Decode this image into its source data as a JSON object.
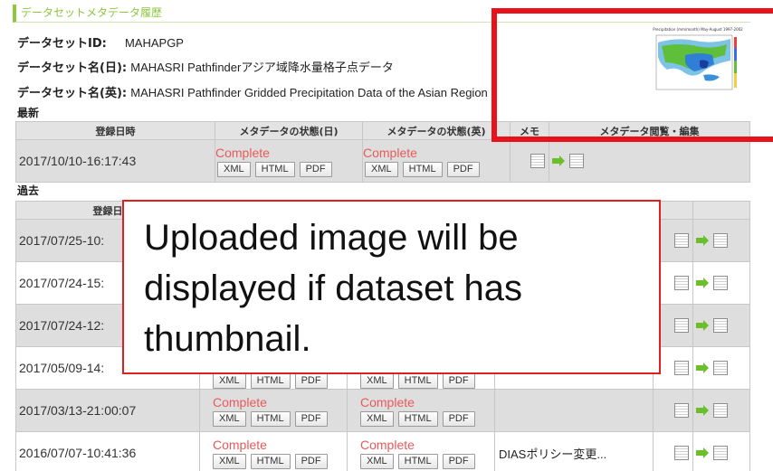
{
  "section_title": "データセットメタデータ履歴",
  "dataset": {
    "id_label": "データセットID:",
    "id_value": "MAHAPGP",
    "name_ja_label": "データセット名(日):",
    "name_ja_value": "MAHASRI Pathfinderアジア域降水量格子点データ",
    "name_en_label": "データセット名(英):",
    "name_en_value": "MAHASRI Pathfinder Gridded Precipitation Data of the Asian Region"
  },
  "latest": {
    "heading": "最新",
    "columns": [
      "登録日時",
      "メタデータの状態(日)",
      "メタデータの状態(英)",
      "メモ",
      "メタデータ閲覧・編集"
    ],
    "row": {
      "date": "2017/10/10-16:17:43",
      "status_ja": "Complete",
      "status_en": "Complete",
      "memo": ""
    }
  },
  "past": {
    "heading": "過去",
    "column_date": "登録日",
    "rows": [
      {
        "date": "2017/07/25-10:",
        "status_ja": "",
        "status_en": "",
        "memo": ""
      },
      {
        "date": "2017/07/24-15:",
        "status_ja": "",
        "status_en": "",
        "memo": ""
      },
      {
        "date": "2017/07/24-12:",
        "status_ja": "",
        "status_en": "",
        "memo": ""
      },
      {
        "date": "2017/05/09-14:",
        "status_ja": "",
        "status_en": "",
        "memo": ""
      },
      {
        "date": "2017/03/13-21:00:07",
        "status_ja": "Complete",
        "status_en": "Complete",
        "memo": ""
      },
      {
        "date": "2016/07/07-10:41:36",
        "status_ja": "Complete",
        "status_en": "Complete",
        "memo": "DIASポリシー変更..."
      }
    ]
  },
  "buttons": {
    "xml": "XML",
    "html": "HTML",
    "pdf": "PDF"
  },
  "thumbnail": {
    "caption": "Precipitation (mm/month) May-August 1997-2002"
  },
  "callout": {
    "line1": "Uploaded image will be",
    "line2": "displayed if dataset has",
    "line3": "thumbnail."
  },
  "icons": [
    "doc-icon",
    "arrow-right-icon",
    "edit-doc-icon"
  ],
  "colors": {
    "accent": "#8dc63f",
    "complete": "#e85a5a",
    "callout_border": "#e8131a"
  }
}
